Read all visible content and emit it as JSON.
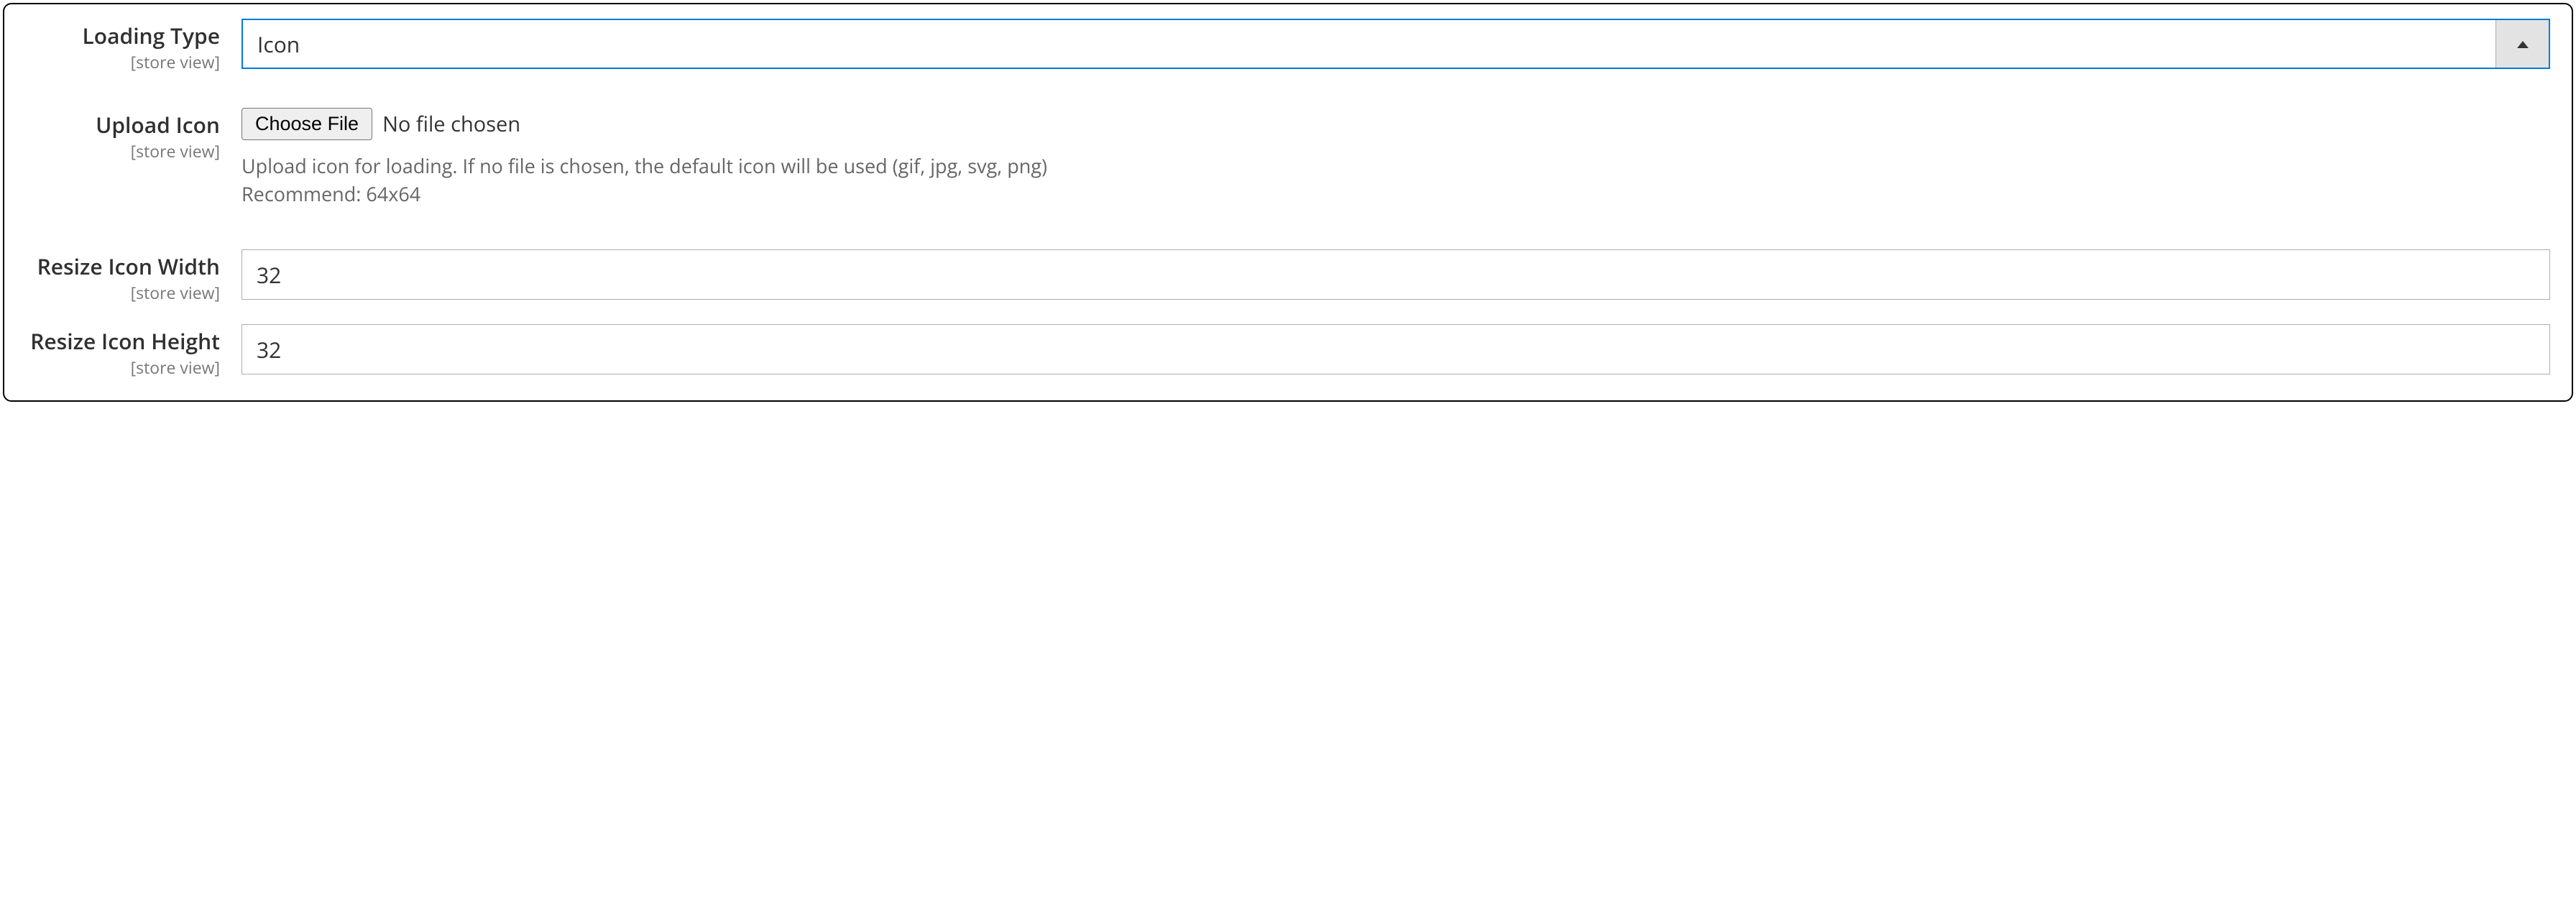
{
  "fields": {
    "loading_type": {
      "label": "Loading Type",
      "scope": "[store view]",
      "value": "Icon"
    },
    "upload_icon": {
      "label": "Upload Icon",
      "scope": "[store view]",
      "button": "Choose File",
      "status": "No file chosen",
      "help_line1": "Upload icon for loading. If no file is chosen, the default icon will be used (gif, jpg, svg, png)",
      "help_line2": "Recommend: 64x64"
    },
    "resize_width": {
      "label": "Resize Icon Width",
      "scope": "[store view]",
      "value": "32"
    },
    "resize_height": {
      "label": "Resize Icon Height",
      "scope": "[store view]",
      "value": "32"
    }
  }
}
